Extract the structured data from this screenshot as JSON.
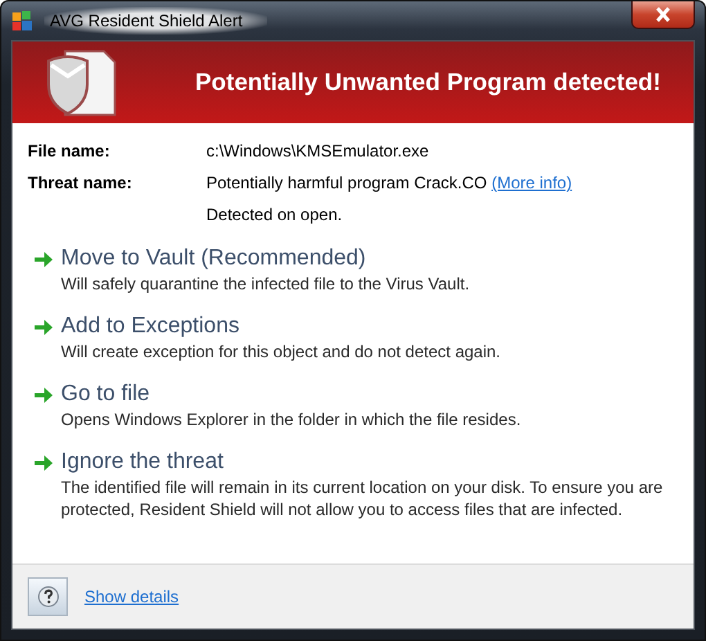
{
  "window": {
    "title": "AVG Resident Shield Alert"
  },
  "header": {
    "title": "Potentially Unwanted Program detected!"
  },
  "details": [
    {
      "label": "File name:",
      "value": "c:\\Windows\\KMSEmulator.exe"
    },
    {
      "label": "Threat name:",
      "value": "Potentially harmful program Crack.CO",
      "link": "(More info)"
    },
    {
      "value": "Detected on open."
    }
  ],
  "actions": [
    {
      "title": "Move to Vault (Recommended)",
      "description": "Will safely quarantine the infected file to the Virus Vault."
    },
    {
      "title": "Add to Exceptions",
      "description": "Will create exception for this object and do not detect again."
    },
    {
      "title": "Go to file",
      "description": "Opens Windows Explorer in the folder in which the file resides."
    },
    {
      "title": "Ignore the threat",
      "description": "The identified file will remain in its current location on your disk. To ensure you are protected, Resident Shield will not allow you to access files that are infected."
    }
  ],
  "footer": {
    "link": "Show details"
  }
}
